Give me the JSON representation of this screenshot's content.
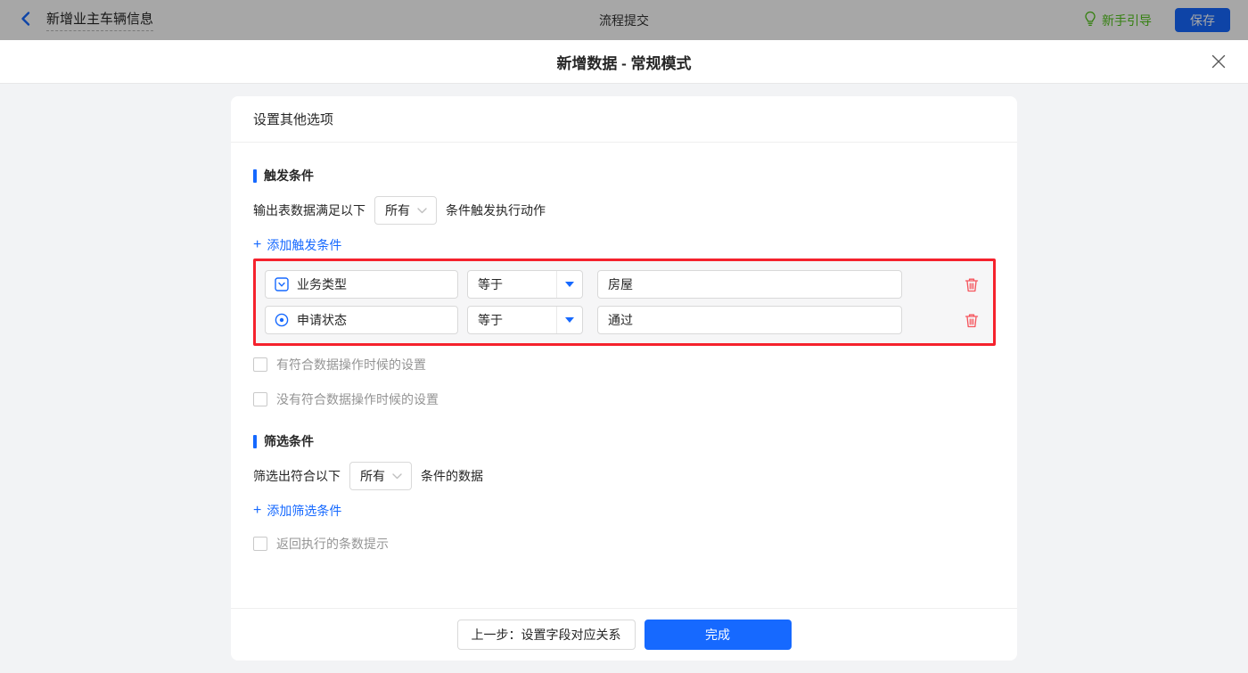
{
  "colors": {
    "accent": "#1669ff",
    "guide_green": "#52c41a",
    "annotation_red": "#f5222d",
    "danger_red": "#f5545c"
  },
  "header": {
    "flow_name": "新增业主车辆信息",
    "center_title": "流程提交",
    "guide_label": "新手引导",
    "save_label": "保存"
  },
  "modal": {
    "title": "新增数据 - 常规模式"
  },
  "panel": {
    "title": "设置其他选项"
  },
  "icons": {
    "plus": "+"
  },
  "trigger_section": {
    "title": "触发条件",
    "match_prefix": "输出表数据满足以下",
    "match_select_value": "所有",
    "match_suffix": "条件触发执行动作",
    "add_link_label": "添加触发条件",
    "conditions": [
      {
        "field": "业务类型",
        "field_type_icon": "dropdown-field-icon",
        "operator": "等于",
        "value": "房屋"
      },
      {
        "field": "申请状态",
        "field_type_icon": "radio-field-icon",
        "operator": "等于",
        "value": "通过"
      }
    ],
    "checkboxes": [
      "有符合数据操作时候的设置",
      "没有符合数据操作时候的设置"
    ]
  },
  "filter_section": {
    "title": "筛选条件",
    "match_prefix": "筛选出符合以下",
    "match_select_value": "所有",
    "match_suffix": "条件的数据",
    "add_link_label": "添加筛选条件",
    "checkbox": "返回执行的条数提示"
  },
  "footer": {
    "prev_label": "上一步：设置字段对应关系",
    "done_label": "完成"
  }
}
